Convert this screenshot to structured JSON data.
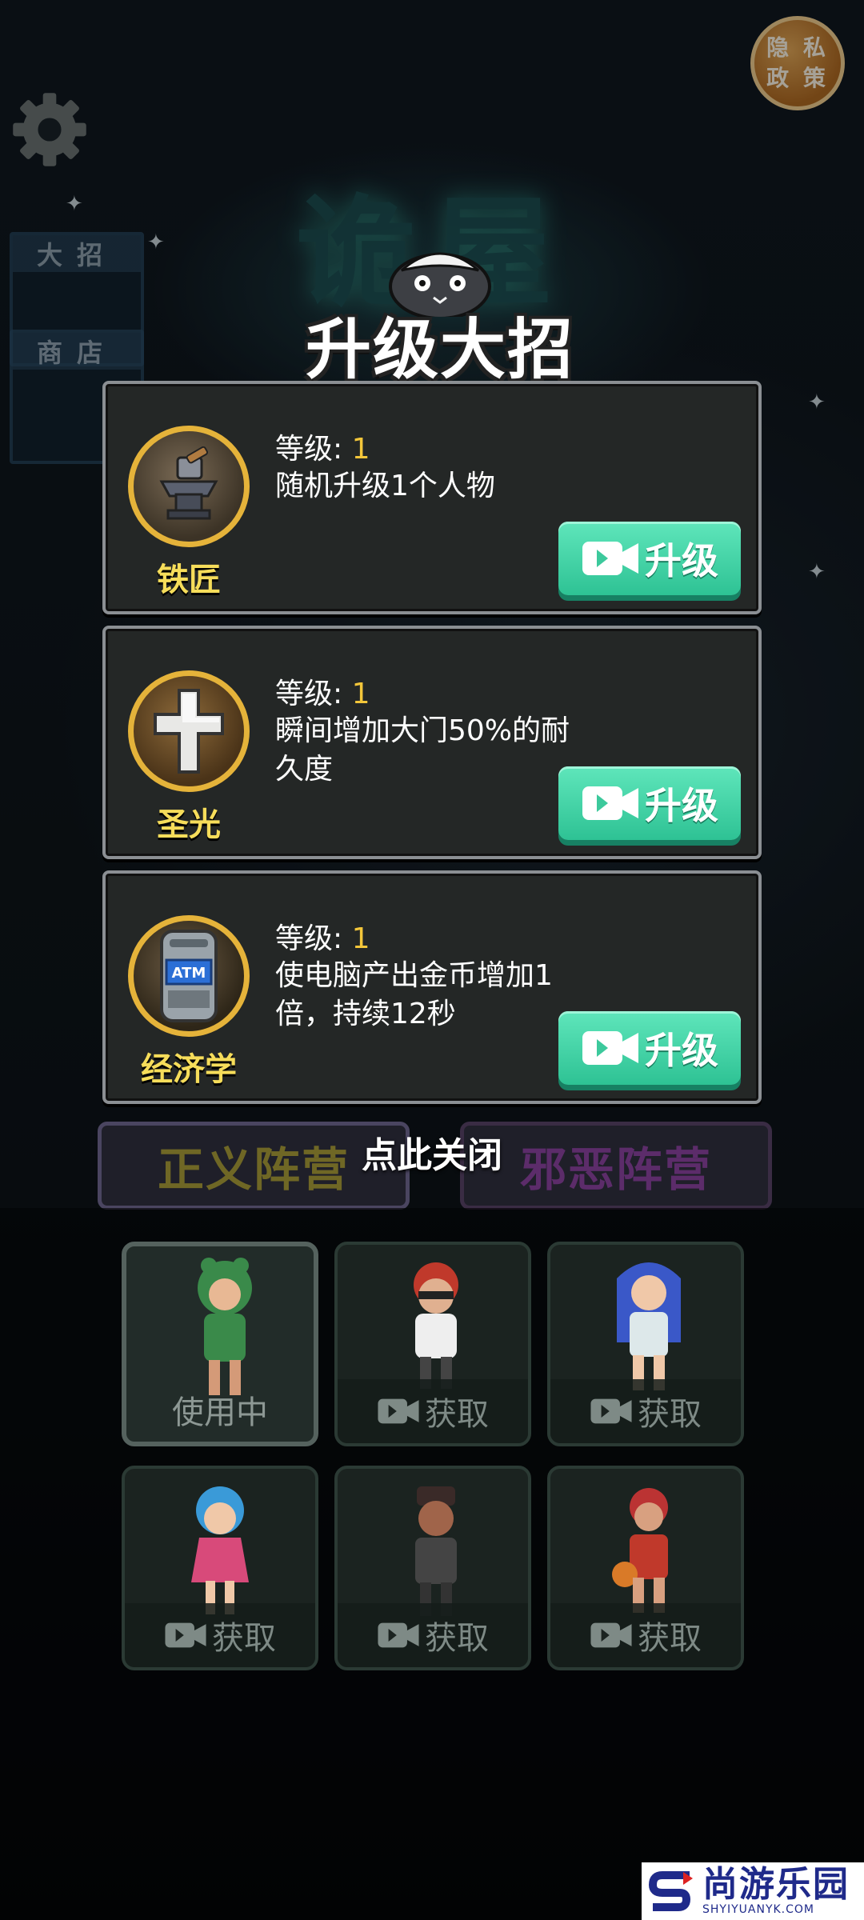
{
  "privacy": {
    "label": "隐私政策",
    "line1": "隐 私",
    "line2": "政 策"
  },
  "background": {
    "title": "诡屋",
    "side_tabs": [
      "大招",
      "商店"
    ],
    "camps": {
      "justice": "正义阵营",
      "evil": "邪恶阵营"
    }
  },
  "dialog": {
    "title": "升级大招",
    "level_label": "等级: ",
    "upgrade_label": "升级",
    "close_label": "点此关闭",
    "skills": [
      {
        "name": "铁匠",
        "level": "1",
        "desc": "随机升级1个人物",
        "icon": "anvil-icon"
      },
      {
        "name": "圣光",
        "level": "1",
        "desc": "瞬间增加大门50%的耐久度",
        "icon": "holy-cross-icon"
      },
      {
        "name": "经济学",
        "level": "1",
        "desc": "使电脑产出金币增加1倍，持续12秒",
        "icon": "atm-icon"
      }
    ]
  },
  "characters": {
    "in_use_label": "使用中",
    "get_label": "获取",
    "items": [
      {
        "state": "in_use",
        "icon": "frog-hood-character"
      },
      {
        "state": "get",
        "icon": "masked-thief-character"
      },
      {
        "state": "get",
        "icon": "blue-hair-girl-character"
      },
      {
        "state": "get",
        "icon": "star-wand-girl-character"
      },
      {
        "state": "get",
        "icon": "gentleman-character"
      },
      {
        "state": "get",
        "icon": "basketball-player-character"
      }
    ]
  },
  "watermark": {
    "main": "尚游乐园",
    "sub": "SHYIYUANYK.COM"
  },
  "colors": {
    "accent": "#3ad0a4",
    "gold": "#f3c63a",
    "card_bg": "#242726"
  }
}
